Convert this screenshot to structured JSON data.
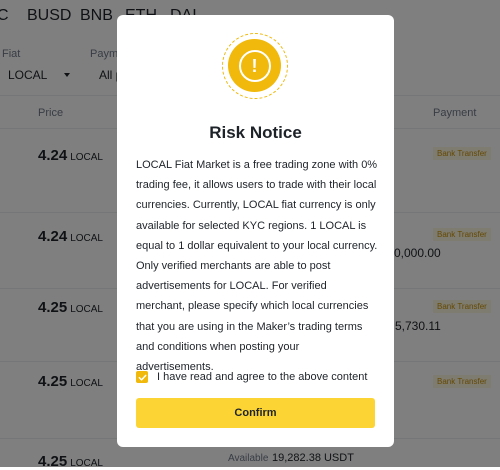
{
  "tabs": [
    "BUSD",
    "BNB",
    "ETH",
    "DAI"
  ],
  "filters": {
    "fiat_label": "Fiat",
    "fiat_value": "LOCAL",
    "payment_label": "Payme",
    "payment_value": "All p"
  },
  "table": {
    "price_header": "Price",
    "payment_header": "Payment",
    "rows": [
      {
        "price": "4.24",
        "currency": "LOCAL",
        "payment": "Bank Transfer"
      },
      {
        "price": "4.24",
        "currency": "LOCAL",
        "payment": "Bank Transfer",
        "amount_fragment": "0,000.00"
      },
      {
        "price": "4.25",
        "currency": "LOCAL",
        "payment": "Bank Transfer",
        "amount_fragment": "5,730.11"
      },
      {
        "price": "4.25",
        "currency": "LOCAL",
        "payment": "Bank Transfer"
      },
      {
        "price": "4.25",
        "currency": "LOCAL",
        "available_label": "Available",
        "available_value": "19,282.38 USDT"
      }
    ]
  },
  "modal": {
    "icon": "warning-exclamation-icon",
    "title": "Risk Notice",
    "body": "LOCAL Fiat Market is a free trading zone with 0% trading fee, it allows users to trade with their local currencies. Currently, LOCAL fiat currency is only available for selected KYC regions. 1 LOCAL is equal to 1 dollar equivalent to your local currency. Only verified merchants are able to post advertisements for LOCAL. For verified merchant, please specify which local currencies that you are using in the Maker’s trading terms and conditions when posting your advertisements.",
    "agree_label": "I have read and agree to the above content",
    "agree_checked": true,
    "confirm_label": "Confirm"
  },
  "colors": {
    "accent": "#f0b90b",
    "button": "#fcd535",
    "overlay": "rgba(0,0,0,0.5)"
  }
}
